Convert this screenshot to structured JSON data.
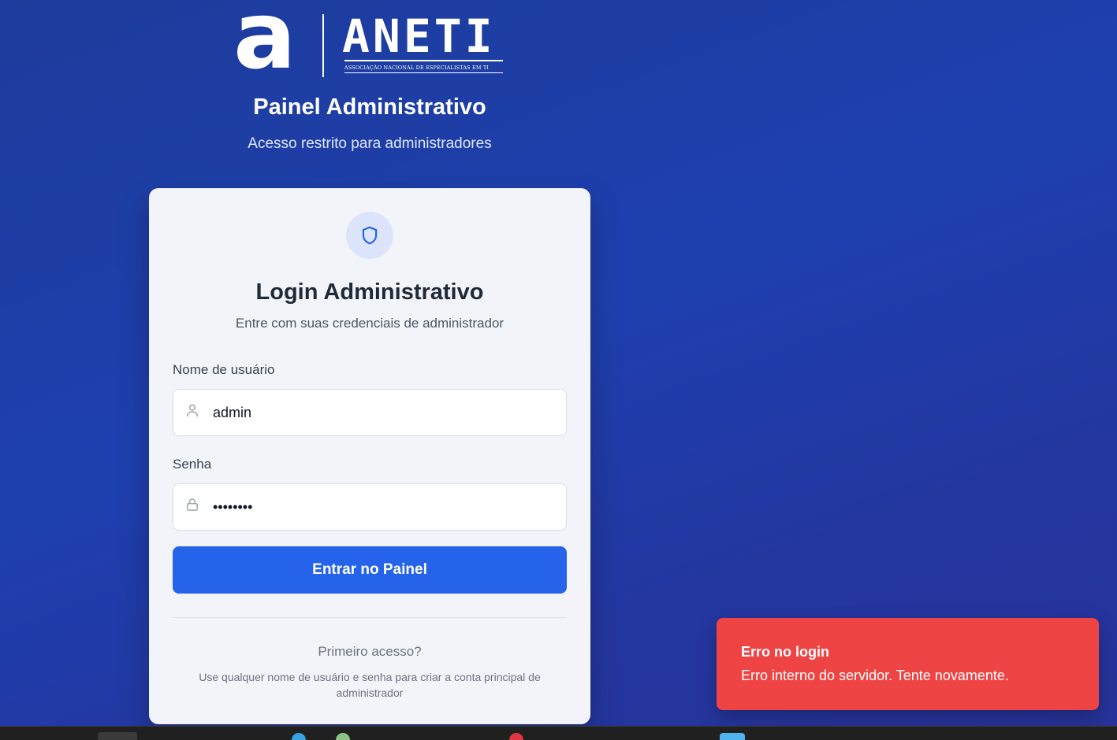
{
  "brand": {
    "logo_letter": "a",
    "logo_word": "ANETI",
    "logo_tagline": "ASSOCIAÇÃO NACIONAL DE ESPECIALISTAS EM TI"
  },
  "header": {
    "title": "Painel Administrativo",
    "subtitle": "Acesso restrito para administradores"
  },
  "card": {
    "icon": "shield-icon",
    "title": "Login Administrativo",
    "subtitle": "Entre com suas credenciais de administrador",
    "username": {
      "label": "Nome de usuário",
      "value": "admin",
      "icon": "user-icon"
    },
    "password": {
      "label": "Senha",
      "value": "••••••••",
      "icon": "lock-icon"
    },
    "submit_label": "Entrar no Painel",
    "first_access_title": "Primeiro acesso?",
    "first_access_note": "Use qualquer nome de usuário e senha para criar a conta principal de administrador"
  },
  "toast": {
    "title": "Erro no login",
    "message": "Erro interno do servidor. Tente novamente.",
    "color": "#ef4444"
  },
  "colors": {
    "primary": "#2563eb",
    "background": "#1e40af",
    "error": "#ef4444"
  }
}
